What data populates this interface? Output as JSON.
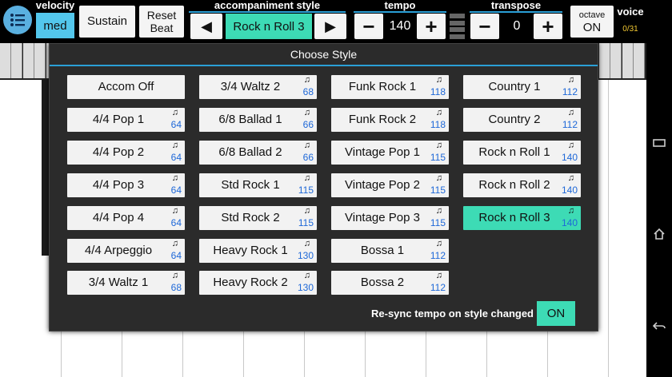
{
  "toolbar": {
    "velocity": {
      "label": "velocity",
      "value": "med"
    },
    "sustain_label": "Sustain",
    "reset_beat": {
      "line1": "Reset",
      "line2": "Beat"
    },
    "accompaniment": {
      "label": "accompaniment style",
      "prev_icon": "left-arrow-icon",
      "next_icon": "right-arrow-icon",
      "value": "Rock n Roll 3",
      "prev_glyph": "◀",
      "next_glyph": "▶"
    },
    "tempo": {
      "label": "tempo",
      "minus": "−",
      "value": "140",
      "plus": "+"
    },
    "transpose": {
      "label": "transpose",
      "minus": "−",
      "value": "0",
      "plus": "+"
    },
    "octave": {
      "label": "octave",
      "value": "ON"
    },
    "voice": {
      "label": "voice",
      "count": "0/31"
    }
  },
  "dialog": {
    "title": "Choose Style",
    "note_glyph": "♫",
    "columns": [
      [
        {
          "name": "Accom Off",
          "tempo": ""
        },
        {
          "name": "4/4 Pop 1",
          "tempo": "64"
        },
        {
          "name": "4/4 Pop 2",
          "tempo": "64"
        },
        {
          "name": "4/4 Pop 3",
          "tempo": "64"
        },
        {
          "name": "4/4 Pop 4",
          "tempo": "64"
        },
        {
          "name": "4/4 Arpeggio",
          "tempo": "64"
        },
        {
          "name": "3/4 Waltz 1",
          "tempo": "68"
        }
      ],
      [
        {
          "name": "3/4 Waltz 2",
          "tempo": "68"
        },
        {
          "name": "6/8 Ballad 1",
          "tempo": "66"
        },
        {
          "name": "6/8 Ballad 2",
          "tempo": "66"
        },
        {
          "name": "Std Rock 1",
          "tempo": "115"
        },
        {
          "name": "Std Rock 2",
          "tempo": "115"
        },
        {
          "name": "Heavy Rock 1",
          "tempo": "130"
        },
        {
          "name": "Heavy Rock 2",
          "tempo": "130"
        }
      ],
      [
        {
          "name": "Funk Rock 1",
          "tempo": "118"
        },
        {
          "name": "Funk Rock 2",
          "tempo": "118"
        },
        {
          "name": "Vintage Pop 1",
          "tempo": "115"
        },
        {
          "name": "Vintage Pop 2",
          "tempo": "115"
        },
        {
          "name": "Vintage Pop 3",
          "tempo": "115"
        },
        {
          "name": "Bossa 1",
          "tempo": "112"
        },
        {
          "name": "Bossa 2",
          "tempo": "112"
        }
      ],
      [
        {
          "name": "Country 1",
          "tempo": "112"
        },
        {
          "name": "Country 2",
          "tempo": "112"
        },
        {
          "name": "Rock n Roll 1",
          "tempo": "140"
        },
        {
          "name": "Rock n Roll 2",
          "tempo": "140"
        },
        {
          "name": "Rock n Roll 3",
          "tempo": "140",
          "selected": true
        }
      ]
    ],
    "resync": {
      "label": "Re-sync tempo on style changed :",
      "value": "ON"
    }
  },
  "colors": {
    "accent_cyan": "#53c7ec",
    "selected_teal": "#3ddbb5",
    "tempo_blue": "#1e68d8",
    "rule_blue": "#2a9fd6"
  },
  "navbar": {
    "icons": [
      "recent-apps-icon",
      "home-icon",
      "back-icon"
    ]
  }
}
